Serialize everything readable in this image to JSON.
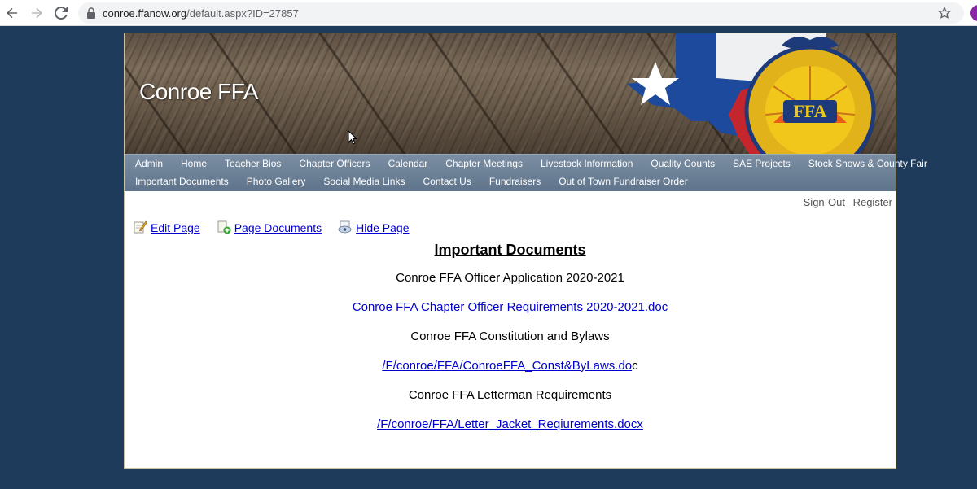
{
  "browser": {
    "url_host": "conroe.ffanow.org",
    "url_path": "/default.aspx?ID=27857"
  },
  "banner": {
    "title": "Conroe FFA"
  },
  "nav": {
    "row1": [
      "Admin",
      "Home",
      "Teacher Bios",
      "Chapter Officers",
      "Calendar",
      "Chapter Meetings",
      "Livestock Information",
      "Quality Counts",
      "SAE Projects",
      "Stock Shows & County Fair"
    ],
    "row2": [
      "Important Documents",
      "Photo Gallery",
      "Social Media Links",
      "Contact Us",
      "Fundraisers",
      "Out of Town Fundraiser Order"
    ]
  },
  "account": {
    "sign_out": "Sign-Out",
    "register": "Register"
  },
  "tools": {
    "edit_page": "Edit Page",
    "page_documents": "Page Documents",
    "hide_page": "Hide Page"
  },
  "content": {
    "heading": "Important Documents",
    "officer_application": "Conroe FFA Officer Application 2020-2021",
    "officer_requirements_link": "Conroe FFA Chapter Officer Requirements 2020-2021.doc",
    "constitution": "Conroe FFA Constitution and Bylaws",
    "constitution_link": "/F/conroe/FFA/ConroeFFA_Const&ByLaws.do",
    "constitution_link_tail": "c",
    "letterman": "Conroe FFA Letterman Requirements",
    "letterman_link": "/F/conroe/FFA/Letter_Jacket_Reqiurements.docx"
  }
}
